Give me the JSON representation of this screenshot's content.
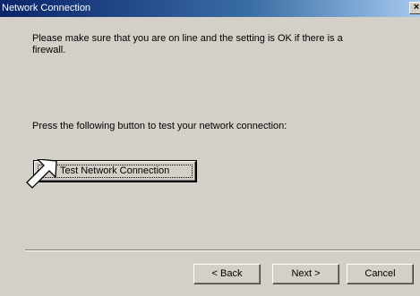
{
  "window": {
    "title": "Network Connection",
    "close_glyph": "×"
  },
  "content": {
    "message": "Please make sure that you are on line and the setting is OK if there is a firewall.",
    "instruction": "Press the following button to test your network connection:",
    "test_button_label": "Test Network Connection"
  },
  "footer": {
    "back_label": "< Back",
    "next_label": "Next >",
    "cancel_label": "Cancel"
  },
  "icons": {
    "pointer": "arrow-pointer-icon",
    "close": "close-icon"
  },
  "colors": {
    "titlebar_start": "#0a246a",
    "titlebar_end": "#a6caf0",
    "dialog_face": "#d4d0c8"
  }
}
